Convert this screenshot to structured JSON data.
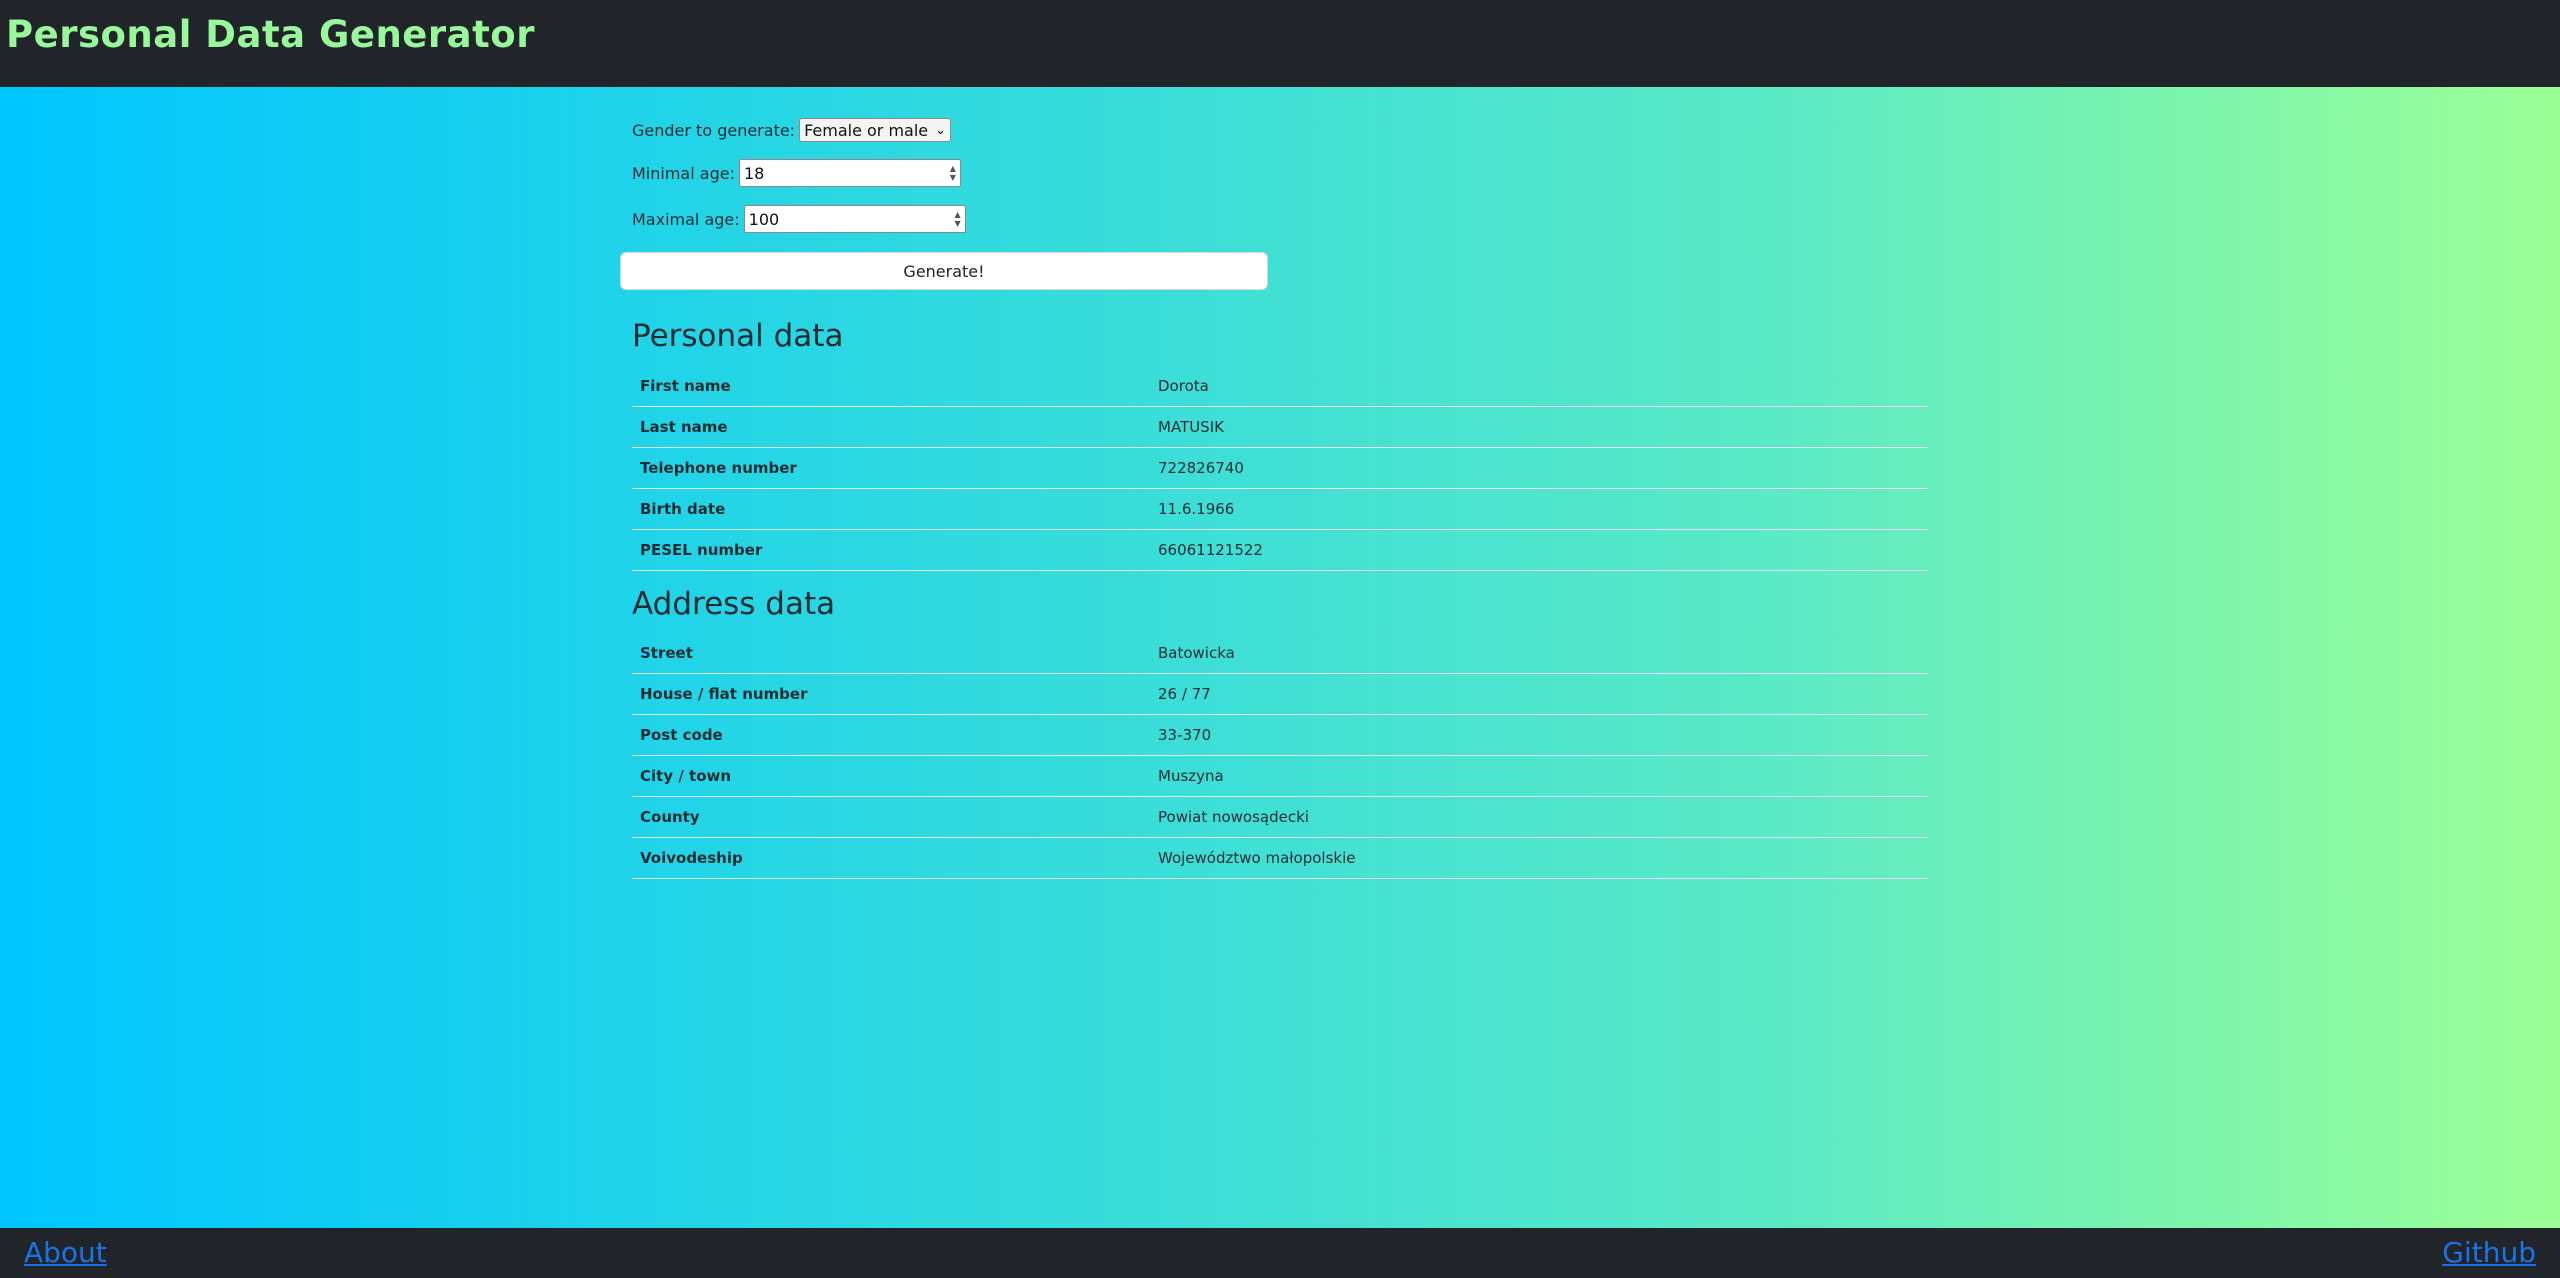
{
  "header": {
    "title": "Personal Data Generator"
  },
  "form": {
    "gender_label": "Gender to generate:",
    "gender_value": "Female or male",
    "min_age_label": "Minimal age:",
    "min_age_value": "18",
    "max_age_label": "Maximal age:",
    "max_age_value": "100",
    "generate_label": "Generate!"
  },
  "personal": {
    "title": "Personal data",
    "rows": [
      {
        "label": "First name",
        "value": "Dorota"
      },
      {
        "label": "Last name",
        "value": "MATUSIK"
      },
      {
        "label": "Telephone number",
        "value": "722826740"
      },
      {
        "label": "Birth date",
        "value": "11.6.1966"
      },
      {
        "label": "PESEL number",
        "value": "66061121522"
      }
    ]
  },
  "address": {
    "title": "Address data",
    "rows": [
      {
        "label": "Street",
        "value": "Batowicka"
      },
      {
        "label": "House / flat number",
        "value": "26 / 77"
      },
      {
        "label": "Post code",
        "value": "33-370"
      },
      {
        "label": "City / town",
        "value": "Muszyna"
      },
      {
        "label": "County",
        "value": "Powiat nowosądecki"
      },
      {
        "label": "Voivodeship",
        "value": "Województwo małopolskie"
      }
    ]
  },
  "footer": {
    "about": "About",
    "github": "Github"
  },
  "colors": {
    "bar": "#212429",
    "title": "#98f79a",
    "gradient_start": "#00c6ff",
    "gradient_end": "#9cff96",
    "link": "#1a73e8"
  }
}
